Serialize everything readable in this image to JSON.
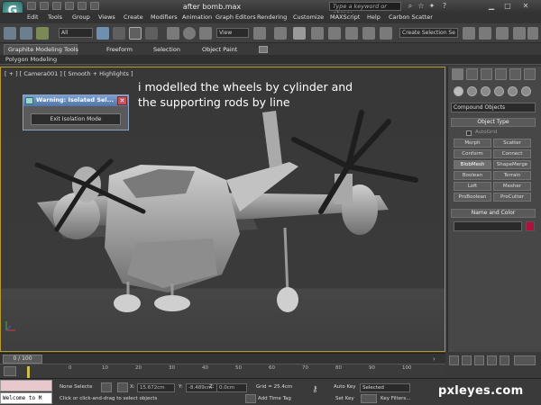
{
  "window": {
    "title": "after bomb.max",
    "search_placeholder": "Type a keyword or phrase",
    "logo": "3ds-max-logo"
  },
  "menu": [
    "Edit",
    "Tools",
    "Group",
    "Views",
    "Create",
    "Modifiers",
    "Animation",
    "Graph Editors",
    "Rendering",
    "Customize",
    "MAXScript",
    "Help",
    "Carbon Scatter"
  ],
  "toolbar": {
    "selection_filter": "All",
    "ref_coord": "View",
    "selection_set": "Create Selection Se"
  },
  "ribbon": {
    "tabs": [
      "Graphite Modeling Tools",
      "Freeform",
      "Selection",
      "Object Paint"
    ],
    "sub_label": "Polygon Modeling"
  },
  "viewport": {
    "label": "[ + ] [ Camera001 ] [ Smooth + Highlights ]",
    "annotation": [
      "i modelled the wheels by cylinder and",
      "the supporting rods by line"
    ]
  },
  "iso_dialog": {
    "title": "Warning: Isolated Sel...",
    "button": "Exit Isolation Mode"
  },
  "command_panel": {
    "category": "Compound Objects",
    "object_type_title": "Object Type",
    "autogrid": "AutoGrid",
    "buttons": [
      "Morph",
      "Scatter",
      "Conform",
      "Connect",
      "BlobMesh",
      "ShapeMerge",
      "Boolean",
      "Terrain",
      "Loft",
      "Mesher",
      "ProBoolean",
      "ProCutter"
    ],
    "active_button": "BlobMesh",
    "name_color_title": "Name and Color",
    "object_color": "#b0103c"
  },
  "timeline": {
    "position": "0 / 100",
    "ticks": [
      "0",
      "10",
      "20",
      "30",
      "40",
      "50",
      "60",
      "70",
      "80",
      "90",
      "100"
    ]
  },
  "status": {
    "listener": "Welcome to M",
    "selection": "None Selecte",
    "prompt": "Click or click-and-drag to select objects",
    "x": "15.672cm",
    "y": "-8.489cm",
    "z": "0.0cm",
    "grid": "Grid = 25.4cm",
    "add_time_tag": "Add Time Tag",
    "auto_key": "Auto Key",
    "set_key": "Set Key",
    "key_mode": "Selected",
    "key_filters": "Key Filters..."
  },
  "watermark": "pxleyes.com"
}
